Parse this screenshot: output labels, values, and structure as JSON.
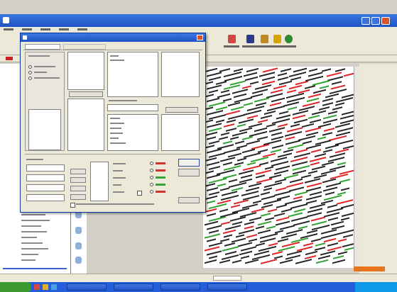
{
  "app": {
    "title": "",
    "menu_items": [],
    "toolbar_items": [
      {
        "icon": "filter-icon",
        "color": "#d64545"
      },
      {
        "icon": "user-icon",
        "color": "#2a3a8a"
      },
      {
        "icon": "people-icon",
        "color": "#c08a20"
      },
      {
        "icon": "lock-icon",
        "color": "#d9a300"
      },
      {
        "icon": "undo-icon",
        "color": "#2f8a2f"
      }
    ]
  },
  "dialog": {
    "title": "",
    "filters": [],
    "buttons": []
  },
  "sidebar": {
    "items": []
  },
  "grid": {
    "token_colors": {
      "red": "#e02020",
      "green": "#2ea02e",
      "black": "#222222"
    }
  },
  "statusbar": {
    "text": ""
  },
  "taskbar": {
    "start_label": "",
    "clock": ""
  },
  "colors": {
    "titlebar": "#2a5fd0",
    "accent_orange": "#e8741c",
    "taskbar": "#245edb",
    "start_green": "#3c9a2e"
  }
}
